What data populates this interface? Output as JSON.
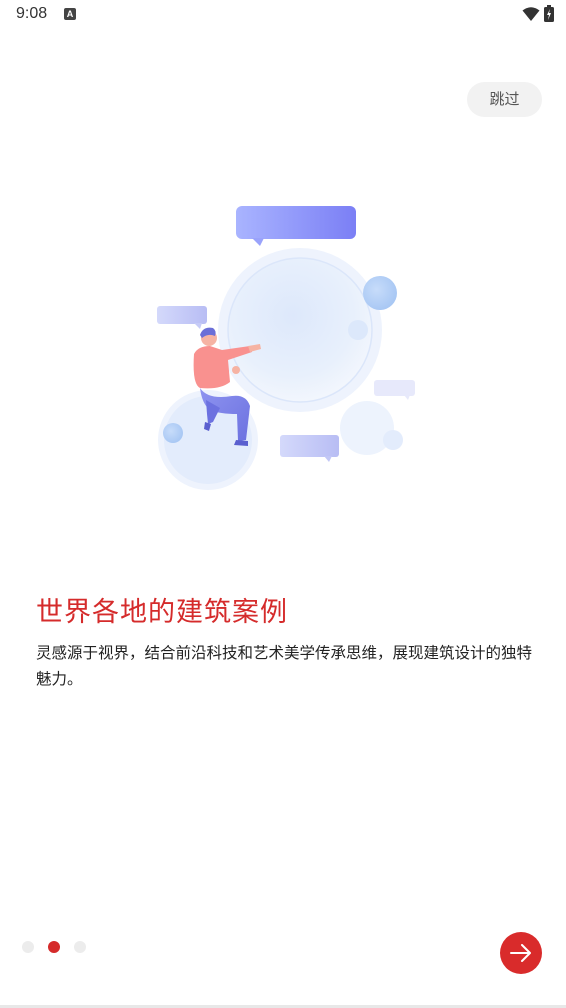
{
  "status_bar": {
    "time": "9:08",
    "notification_icon": "a-letter-icon",
    "wifi_icon": "wifi-icon",
    "battery_icon": "battery-charging-icon"
  },
  "skip": {
    "label": "跳过"
  },
  "illustration": {
    "icon": "person-with-bubbles-illustration"
  },
  "content": {
    "title": "世界各地的建筑案例",
    "description": "灵感源于视界，结合前沿科技和艺术美学传承思维，展现建筑设计的独特魅力。"
  },
  "pager": {
    "total": 3,
    "current": 2
  },
  "next_button": {
    "icon": "arrow-right-icon"
  },
  "colors": {
    "accent": "#d52b2b",
    "skip_bg": "#f2f2f2",
    "dot_inactive": "#ececec"
  }
}
